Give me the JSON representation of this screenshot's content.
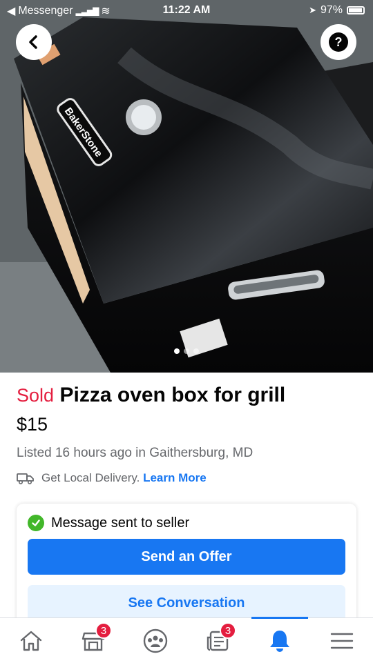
{
  "status_bar": {
    "back_app": "Messenger",
    "time": "11:22 AM",
    "battery": "97%"
  },
  "photo": {
    "brand_text": "BakerStone",
    "page_count": 3,
    "current_page": 1
  },
  "listing": {
    "status": "Sold",
    "title": "Pizza oven box for grill",
    "price": "$15",
    "listed": "Listed 16 hours ago in Gaithersburg, MD",
    "delivery_text": "Get Local Delivery.",
    "delivery_link": "Learn More"
  },
  "card": {
    "message_status": "Message sent to seller",
    "offer_button": "Send an Offer",
    "conversation_button": "See Conversation"
  },
  "tab_bar": {
    "tabs": [
      {
        "icon": "home-icon"
      },
      {
        "icon": "marketplace-icon",
        "badge": "3"
      },
      {
        "icon": "groups-icon"
      },
      {
        "icon": "news-icon",
        "badge": "3"
      },
      {
        "icon": "bell-icon",
        "active": true
      },
      {
        "icon": "menu-icon"
      }
    ]
  },
  "colors": {
    "accent": "#1877f2",
    "sold": "#e41e3f",
    "success": "#42b72a",
    "secondary_button_bg": "#e7f3ff"
  }
}
